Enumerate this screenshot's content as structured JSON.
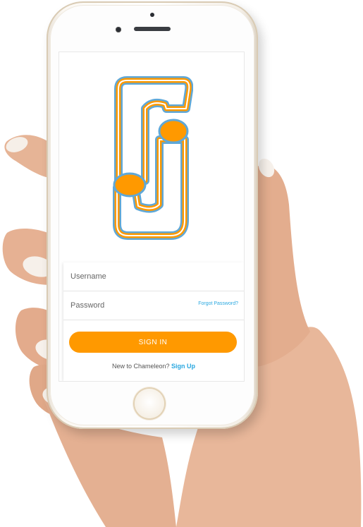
{
  "login": {
    "username_placeholder": "Username",
    "password_placeholder": "Password",
    "forgot_password": "Forgot Password?",
    "sign_in": "SIGN IN",
    "signup_prompt": "New to Chameleon?",
    "signup_link": "Sign Up"
  },
  "colors": {
    "accent": "#ff9900",
    "link": "#2aa8e0",
    "logo_orange": "#ff9900",
    "logo_outline": "#5fa8d8"
  },
  "logo": {
    "icon": "chameleon-cj-logo"
  }
}
